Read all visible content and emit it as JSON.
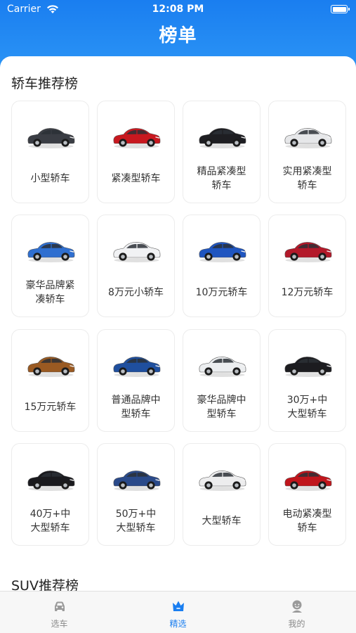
{
  "status_bar": {
    "carrier": "Carrier",
    "time": "12:08 PM"
  },
  "header": {
    "title": "榜单"
  },
  "sections": [
    {
      "title": "轿车推荐榜",
      "items": [
        {
          "label": "小型轿车",
          "color": "#3a3d44"
        },
        {
          "label": "紧凑型轿车",
          "color": "#c8181f"
        },
        {
          "label": "精品紧凑型轿车",
          "color": "#1e1e22"
        },
        {
          "label": "实用紧凑型轿车",
          "color": "#e6e7e9"
        },
        {
          "label": "豪华品牌紧凑轿车",
          "color": "#2f6fd0"
        },
        {
          "label": "8万元小轿车",
          "color": "#f1f2f4"
        },
        {
          "label": "10万元轿车",
          "color": "#1f55c0"
        },
        {
          "label": "12万元轿车",
          "color": "#b3192a"
        },
        {
          "label": "15万元轿车",
          "color": "#9a5a22"
        },
        {
          "label": "普通品牌中型轿车",
          "color": "#1f4f9e"
        },
        {
          "label": "豪华品牌中型轿车",
          "color": "#eceef0"
        },
        {
          "label": "30万+中大型轿车",
          "color": "#1c1c20"
        },
        {
          "label": "40万+中大型轿车",
          "color": "#1a1a1e"
        },
        {
          "label": "50万+中大型轿车",
          "color": "#2a4a8a"
        },
        {
          "label": "大型轿车",
          "color": "#ededee"
        },
        {
          "label": "电动紧凑型轿车",
          "color": "#c0151c"
        }
      ]
    },
    {
      "title": "SUV推荐榜",
      "items": []
    }
  ],
  "tabbar": {
    "tabs": [
      {
        "label": "选车",
        "icon": "car-icon",
        "active": false
      },
      {
        "label": "精选",
        "icon": "crown-icon",
        "active": true
      },
      {
        "label": "我的",
        "icon": "profile-icon",
        "active": false
      }
    ],
    "active_color": "#1a7ef0",
    "inactive_color": "#8a8a8a"
  },
  "colors": {
    "brand": "#1a7ef0"
  }
}
